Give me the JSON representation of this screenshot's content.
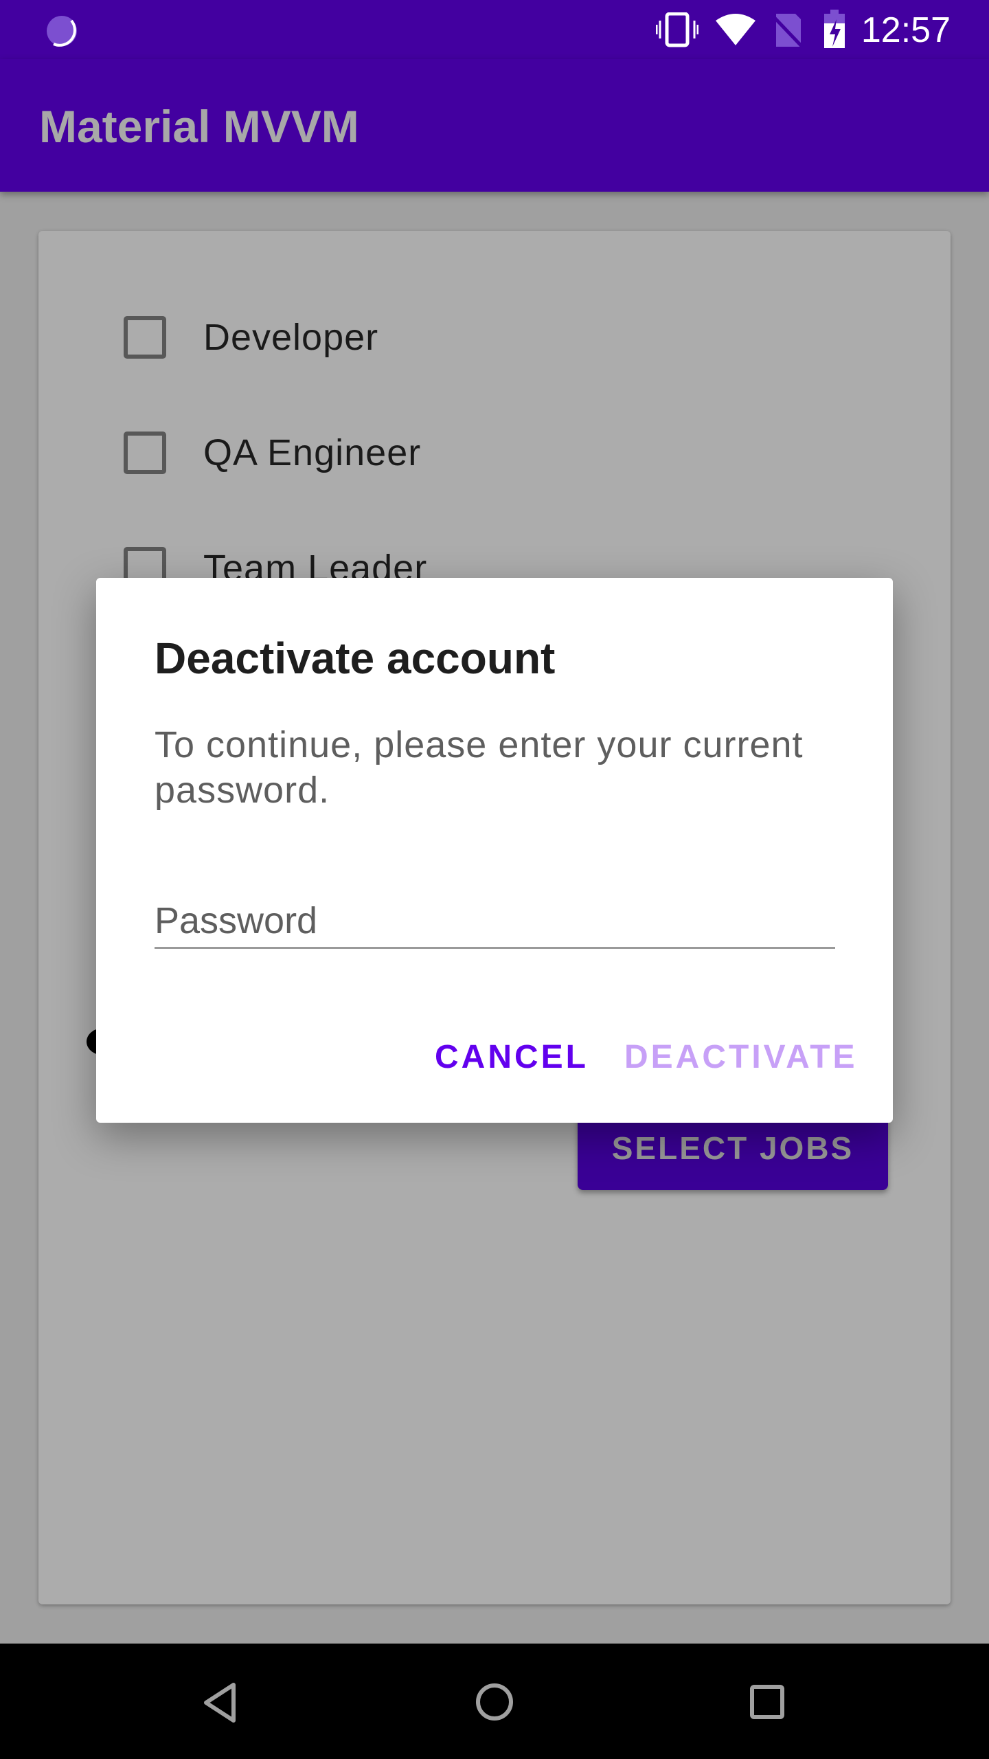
{
  "status_bar": {
    "time": "12:57",
    "icons": [
      "sync-icon",
      "vibrate-icon",
      "wifi-icon",
      "no-sim-icon",
      "battery-charging-icon"
    ]
  },
  "app_bar": {
    "title": "Material MVVM"
  },
  "card": {
    "checkboxes": [
      {
        "label": "Developer",
        "checked": false
      },
      {
        "label": "QA Engineer",
        "checked": false
      },
      {
        "label": "Team Leader",
        "checked": false
      }
    ],
    "select_jobs_label": "SELECT JOBS"
  },
  "dialog": {
    "title": "Deactivate account",
    "message": "To continue, please enter your current password.",
    "password_placeholder": "Password",
    "password_value": "",
    "cancel_label": "CANCEL",
    "deactivate_label": "DEACTIVATE",
    "colors": {
      "cancel": "#6200ee",
      "deactivate_disabled": "#c7a0f7"
    }
  },
  "nav_bar": {
    "icons": [
      "back-icon",
      "home-icon",
      "recents-icon"
    ]
  }
}
